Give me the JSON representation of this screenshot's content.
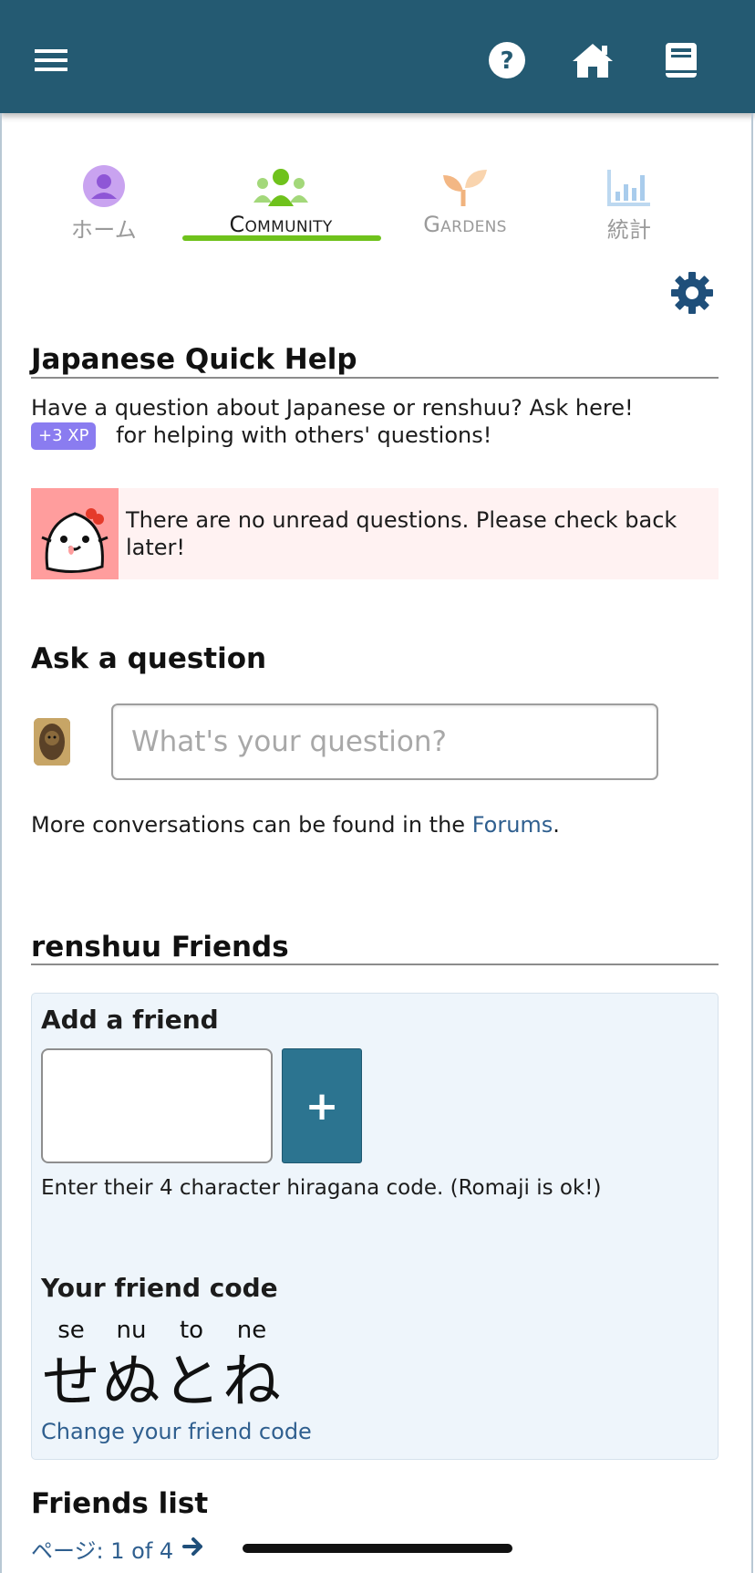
{
  "header": {
    "menu_icon": "hamburger-icon",
    "actions": [
      "help-icon",
      "home-icon",
      "book-icon"
    ]
  },
  "tabs": [
    {
      "label": "ホーム",
      "icon": "user-icon",
      "active": false
    },
    {
      "label": "Community",
      "icon": "group-icon",
      "active": true
    },
    {
      "label": "Gardens",
      "icon": "sprout-icon",
      "active": false
    },
    {
      "label": "統計",
      "icon": "bar-chart-icon",
      "active": false
    }
  ],
  "quick_help": {
    "title": "Japanese Quick Help",
    "description": "Have a question about Japanese or renshuu? Ask here!",
    "xp_badge": "+3 XP",
    "xp_text": "for helping with others' questions!",
    "notice": "There are no unread questions. Please check back later!"
  },
  "ask": {
    "title": "Ask a question",
    "placeholder": "What's your question?",
    "forums_prefix": "More conversations can be found in the ",
    "forums_link": "Forums",
    "forums_suffix": "."
  },
  "friends": {
    "title": "renshuu Friends",
    "add_title": "Add a friend",
    "add_button": "+",
    "add_hint": "Enter their 4 character hiragana code. (Romaji is ok!)",
    "code_title": "Your friend code",
    "code": [
      {
        "romaji": "se",
        "kana": "せ"
      },
      {
        "romaji": "nu",
        "kana": "ぬ"
      },
      {
        "romaji": "to",
        "kana": "と"
      },
      {
        "romaji": "ne",
        "kana": "ね"
      }
    ],
    "change_link": "Change your friend code",
    "list_title": "Friends list",
    "pager": "ページ: 1 of 4"
  },
  "colors": {
    "header_bg": "#245a72",
    "tab_active": "#6fc21c",
    "xp_badge": "#8a7cf0",
    "notice_bg": "#fff2f2",
    "add_button": "#2c7490",
    "link": "#2f5f8f"
  }
}
